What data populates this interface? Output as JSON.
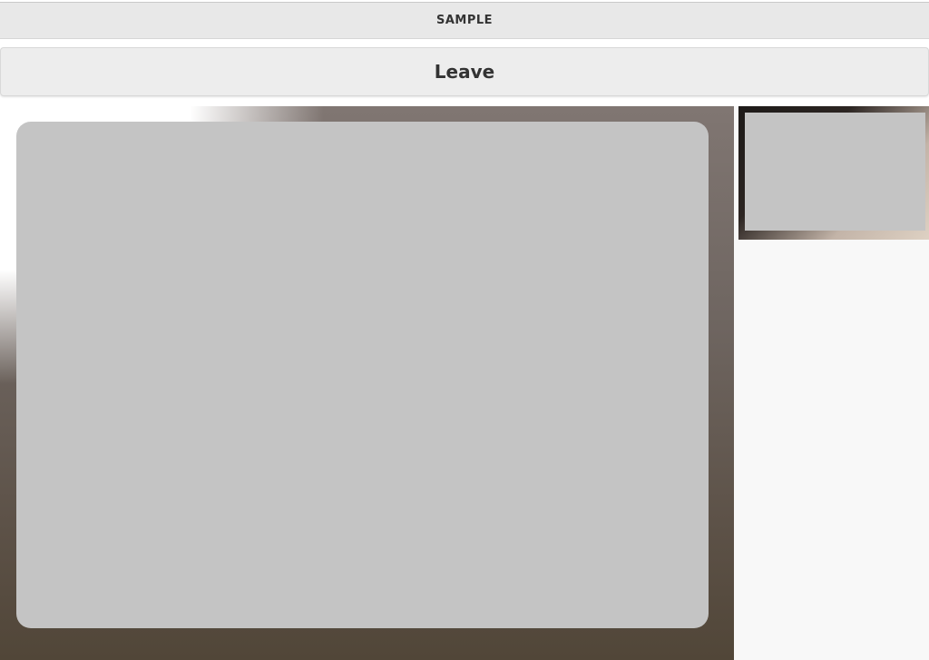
{
  "header": {
    "title": "SAMPLE"
  },
  "controls": {
    "leave_label": "Leave"
  },
  "colors": {
    "header_bg": "#e8e8e8",
    "button_bg": "#ededed",
    "video_placeholder": "#c4c4c4",
    "side_panel_bg": "#f8f8f8"
  }
}
